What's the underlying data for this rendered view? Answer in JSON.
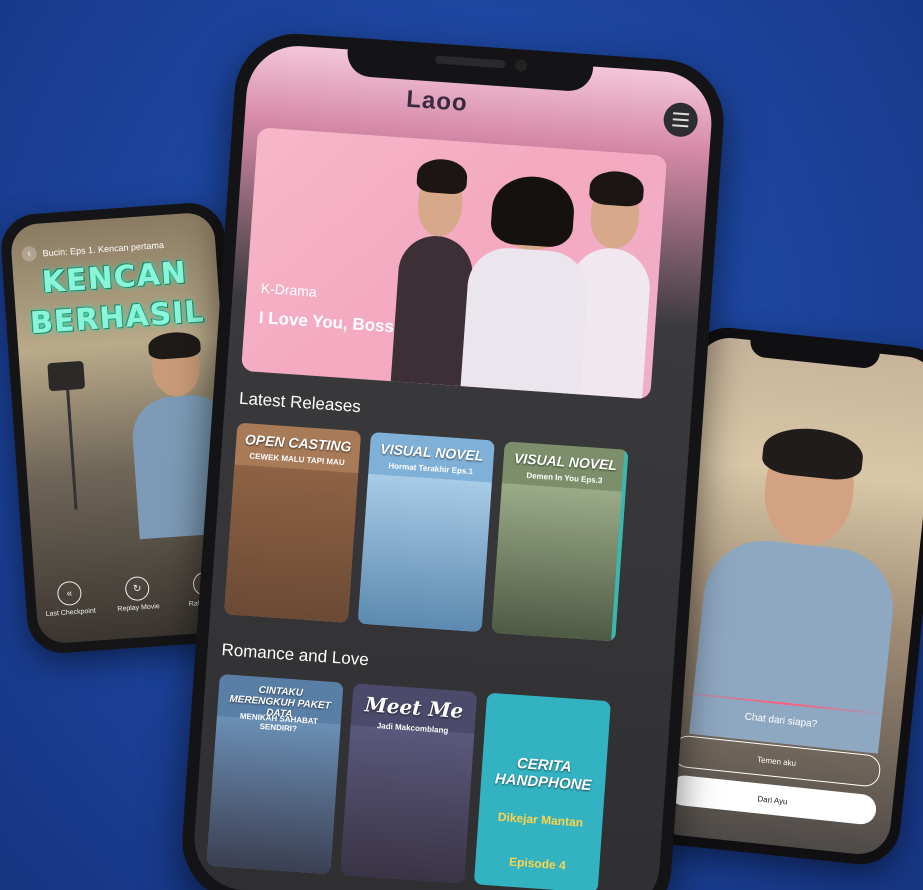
{
  "left_phone": {
    "breadcrumb": "Bucin: Eps 1. Kencan pertama",
    "overlay_title_line1": "KENCAN",
    "overlay_title_line2": "BERHASIL",
    "controls": [
      {
        "icon": "rewind-icon",
        "label": "Last Checkpoint"
      },
      {
        "icon": "replay-icon",
        "label": "Replay Movie"
      },
      {
        "icon": "star-icon",
        "label": "Rate Movie"
      }
    ]
  },
  "center_phone": {
    "logo_text": "Laoo",
    "hero": {
      "category": "K-Drama",
      "title": "I Love You, Boss"
    },
    "sections": [
      {
        "title": "Latest Releases",
        "cards": [
          {
            "label": "OPEN CASTING",
            "sub": "CEWEK MALU TAPI MAU",
            "color": "#a87a58"
          },
          {
            "label": "VISUAL NOVEL",
            "sub": "Hormat Terakhir Eps.1",
            "color": "#7fb1d8"
          },
          {
            "label": "VISUAL NOVEL",
            "sub": "Demen In You Eps.3",
            "color": "#7c8f6a"
          }
        ]
      },
      {
        "title": "Romance and Love",
        "cards": [
          {
            "label": "CINTAKU MERENGKUH PAKET DATA",
            "sub": "MENIKAH SAHABAT SENDIRI?",
            "color": "#5a7fa6"
          },
          {
            "label": "Meet Me",
            "sub": "Jadi Makcomblang",
            "color": "#4b4a6a"
          },
          {
            "label": "CERITA HANDPHONE",
            "sub": "Dikejar Mantan",
            "episode": "Episode 4",
            "color": "#33b3c2"
          }
        ]
      }
    ]
  },
  "right_phone": {
    "question": "Chat dari siapa?",
    "options": [
      "Temen aku",
      "Dari Ayu"
    ]
  }
}
